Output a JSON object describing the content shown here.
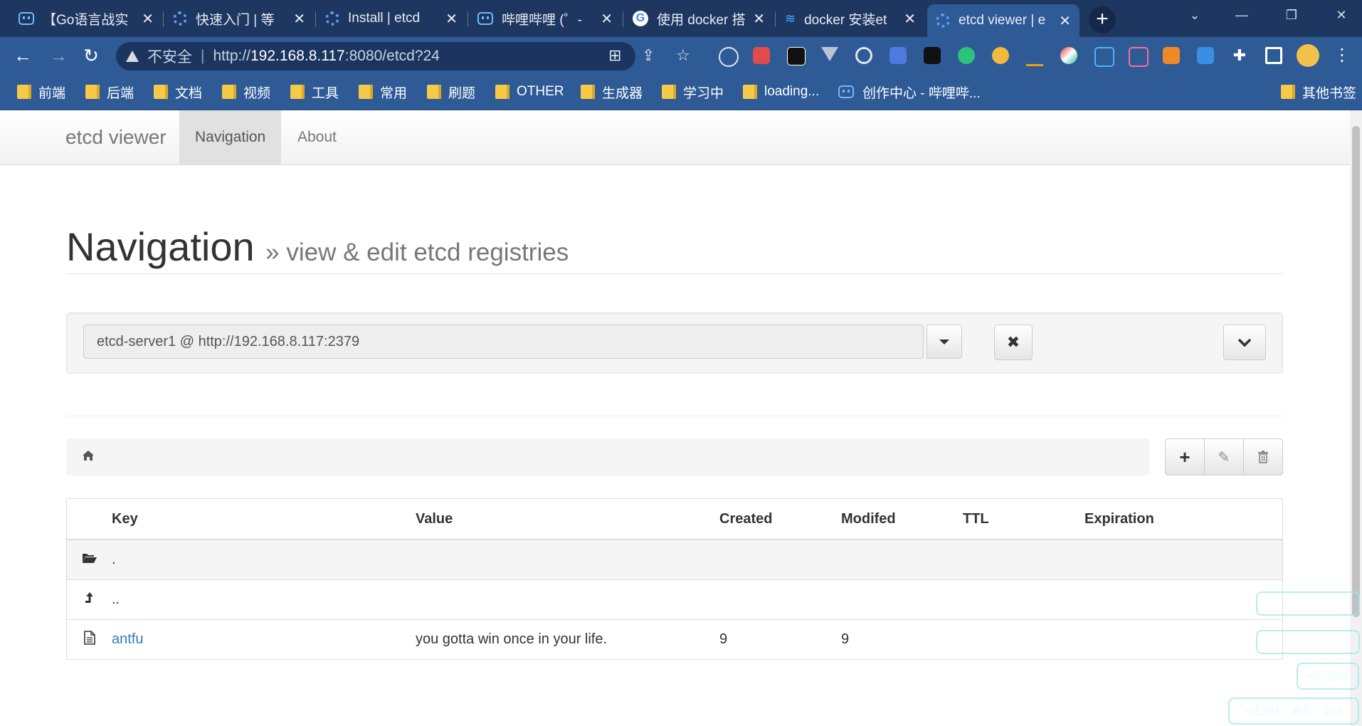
{
  "browser": {
    "tabs": [
      {
        "title": "【Go语言战实",
        "favicon": "bilibili-icon"
      },
      {
        "title": "快速入门 | 等",
        "favicon": "gear-icon"
      },
      {
        "title": "Install | etcd",
        "favicon": "gear-icon"
      },
      {
        "title": "哔哩哔哩 (゜-",
        "favicon": "bilibili-icon"
      },
      {
        "title": "使用 docker 搭",
        "favicon": "google-icon"
      },
      {
        "title": "docker 安装et",
        "favicon": "dock-icon"
      },
      {
        "title": "etcd viewer | e",
        "favicon": "gear-icon"
      }
    ],
    "new_tab_label": "+",
    "address": {
      "security_label": "不安全",
      "url_scheme": "http://",
      "url_host": "192.168.8.117",
      "url_rest": ":8080/etcd?24"
    },
    "bookmarks": [
      "前端",
      "后端",
      "文档",
      "视频",
      "工具",
      "常用",
      "刷题",
      "OTHER",
      "生成器",
      "学习中",
      "loading...",
      "创作中心 - 哔哩哔..."
    ],
    "other_bookmarks": "其他书签"
  },
  "app": {
    "brand": "etcd viewer",
    "nav": [
      "Navigation",
      "About"
    ],
    "header": {
      "title": "Navigation",
      "subtitle": "» view & edit etcd registries"
    },
    "server_select": {
      "value": "etcd-server1 @ http://192.168.8.117:2379"
    },
    "table": {
      "columns": [
        "Key",
        "Value",
        "Created",
        "Modifed",
        "TTL",
        "Expiration"
      ],
      "rows": [
        {
          "icon": "folder-open-icon",
          "key": ".",
          "value": "",
          "created": "",
          "modified": "",
          "ttl": "",
          "expiration": ""
        },
        {
          "icon": "level-up-icon",
          "key": "..",
          "value": "",
          "created": "",
          "modified": "",
          "ttl": "",
          "expiration": ""
        },
        {
          "icon": "file-icon",
          "key": "antfu",
          "value": "you gotta win once in your life.",
          "created": "9",
          "modified": "9",
          "ttl": "",
          "expiration": ""
        }
      ]
    }
  },
  "overlay": {
    "keys1": "<Ctrl>",
    "keys2": "<Ctrl - Alt - a>"
  }
}
